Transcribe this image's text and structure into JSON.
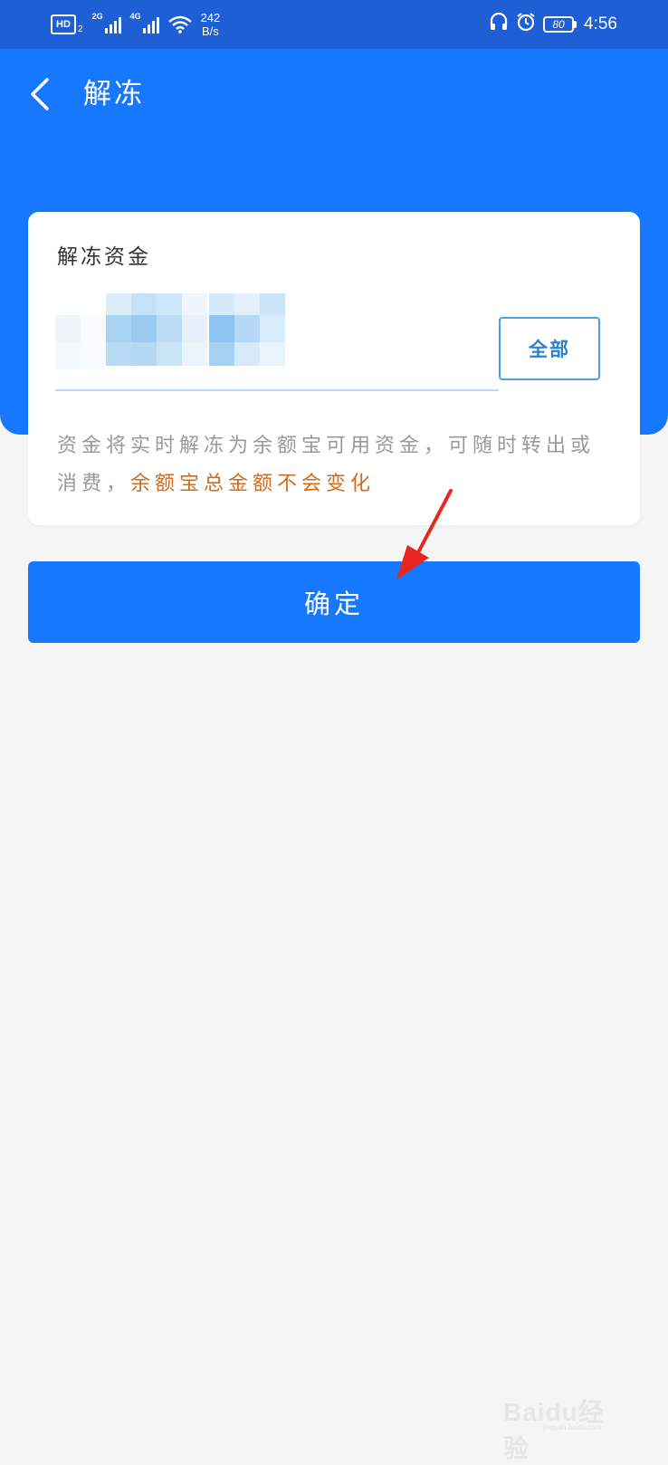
{
  "status_bar": {
    "hd_label": "HD",
    "hd_sub": "2",
    "signal1_label": "2G",
    "signal2_label": "4G",
    "speed_value": "242",
    "speed_unit": "B/s",
    "battery_level": "80",
    "time": "4:56"
  },
  "header": {
    "title": "解冻"
  },
  "card": {
    "label": "解冻资金",
    "all_button_label": "全部",
    "note_text": "资金将实时解冻为余额宝可用资金，可随时转出或消费，",
    "note_highlight": "余额宝总金额不会变化"
  },
  "confirm_button_label": "确定",
  "watermark": {
    "brand": "Baidu经验",
    "url": "jingyan.baidu.com"
  },
  "colors": {
    "status_bar": "#1f5fd6",
    "primary": "#1677ff",
    "highlight_text": "#d26a1b",
    "annotation_arrow": "#e8261f"
  }
}
